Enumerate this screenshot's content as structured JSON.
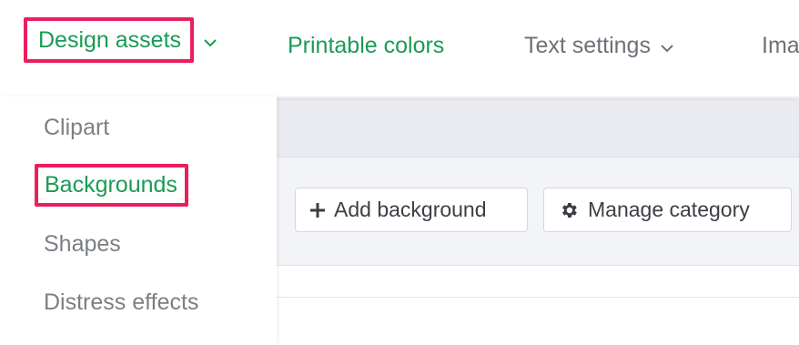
{
  "colors": {
    "accent_green": "#1a9b54",
    "highlight_pink": "#ea1f5d",
    "muted_text": "#6d7278"
  },
  "topnav": {
    "design_assets": "Design assets",
    "printable_colors": "Printable colors",
    "text_settings": "Text settings",
    "images_partial": "Ima"
  },
  "dropdown": {
    "items": [
      "Clipart",
      "Backgrounds",
      "Shapes",
      "Distress effects"
    ],
    "selected": "Backgrounds"
  },
  "toolbar": {
    "add_background": "Add background",
    "manage_category": "Manage category"
  },
  "icons": {
    "design_assets_caret": "chevron-down-icon",
    "text_settings_caret": "chevron-down-icon",
    "add": "plus-icon",
    "manage": "gear-icon"
  }
}
